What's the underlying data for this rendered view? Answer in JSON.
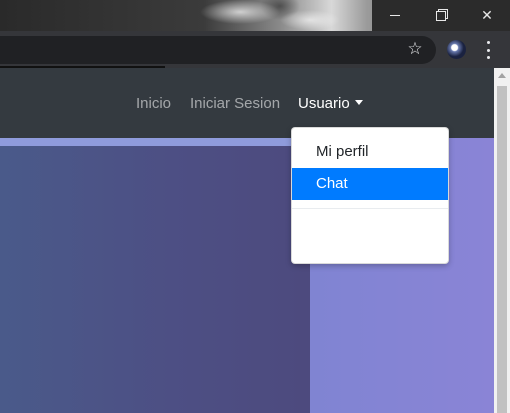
{
  "window": {
    "controls": {
      "minimize": "",
      "restore": "",
      "close": "✕"
    }
  },
  "toolbar": {
    "star_icon": "star-icon",
    "profile_icon": "avatar",
    "menu_icon": "kebab-menu-icon"
  },
  "navbar": {
    "links": [
      "Inicio",
      "Iniciar Sesion"
    ],
    "user_menu_label": "Usuario"
  },
  "dropdown": {
    "items": [
      "Mi perfil",
      "Chat"
    ],
    "active_item": "Chat"
  },
  "colors": {
    "navbar_bg": "#343a40",
    "dropdown_active": "#007bff",
    "hero_light": "#7f84d2",
    "hero_dark": "#4d4f84"
  }
}
